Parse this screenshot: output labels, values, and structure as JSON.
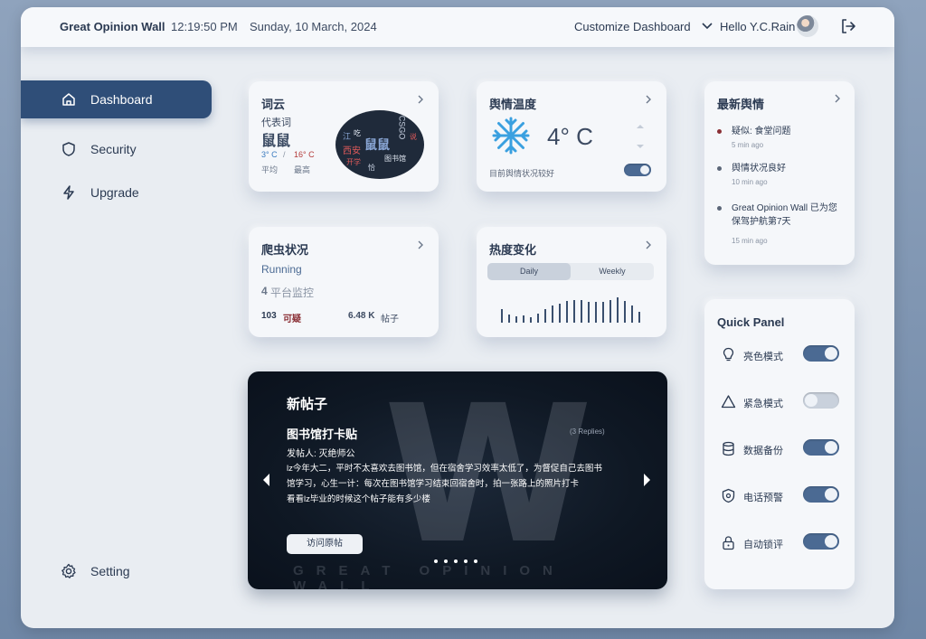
{
  "topbar": {
    "brand": "Great Opinion Wall",
    "time": "12:19:50 PM",
    "date": "Sunday, 10 March, 2024",
    "customize": "Customize Dashboard",
    "hello": "Hello Y.C.Rain"
  },
  "sidebar": {
    "items": [
      {
        "label": "Dashboard",
        "icon": "home-icon",
        "active": true
      },
      {
        "label": "Security",
        "icon": "shield-icon"
      },
      {
        "label": "Upgrade",
        "icon": "lightning-icon"
      }
    ],
    "setting": "Setting"
  },
  "wordcloud": {
    "title": "词云",
    "rep_label": "代表词",
    "word": "鼠鼠",
    "temp_low": "3° C",
    "sep": "/",
    "temp_high": "16° C",
    "avg_label": "平均",
    "max_label": "最高",
    "cloud_words": [
      "鼠鼠",
      "CSGO",
      "西安",
      "开学",
      "图书馆",
      "说",
      "吃",
      "江",
      "恰"
    ]
  },
  "sentiment": {
    "title": "舆情温度",
    "value": "4° C",
    "status": "目前舆情状况较好"
  },
  "news": {
    "title": "最新舆情",
    "items": [
      {
        "text": "疑似: 食堂问题",
        "time": "5 min ago",
        "color": "#8a2f35"
      },
      {
        "text": "舆情状况良好",
        "time": "10 min ago",
        "color": "#5b6678"
      },
      {
        "text": "Great Opinion Wall 已为您保驾护航第7天",
        "time": "15 min ago",
        "color": "#5b6678"
      }
    ]
  },
  "crawler": {
    "title": "爬虫状况",
    "status": "Running",
    "platforms_num": "4",
    "platforms_label": "平台监控",
    "suspicious_num": "103",
    "suspicious_label": "可疑",
    "posts_num": "6.48 K",
    "posts_label": "帖子"
  },
  "heat": {
    "title": "热度变化",
    "tabs": [
      "Daily",
      "Weekly"
    ],
    "active_tab": "Daily",
    "values": [
      14,
      9,
      7,
      8,
      6,
      10,
      14,
      18,
      20,
      23,
      24,
      24,
      22,
      22,
      22,
      24,
      27,
      23,
      18,
      12
    ]
  },
  "quick_panel": {
    "title": "Quick Panel",
    "items": [
      {
        "label": "亮色模式",
        "icon": "bulb-icon",
        "on": true
      },
      {
        "label": "紧急模式",
        "icon": "warning-icon",
        "on": false
      },
      {
        "label": "数据备份",
        "icon": "database-icon",
        "on": true
      },
      {
        "label": "电话预警",
        "icon": "shield-alert-icon",
        "on": true
      },
      {
        "label": "自动锁评",
        "icon": "lock-icon",
        "on": true
      }
    ]
  },
  "post": {
    "section": "新帖子",
    "title": "图书馆打卡贴",
    "replies": "(3 Replies)",
    "author": "发帖人: 灭绝师公",
    "body_line1": "lz今年大二，平时不太喜欢去图书馆，但在宿舍学习效率太低了，为督促自己去图书",
    "body_line2": "馆学习，心生一计：每次在图书馆学习结束回宿舍时，拍一张路上的照片打卡",
    "body_line3": "看看lz毕业的时候这个帖子能有多少楼",
    "button": "访问原帖",
    "watermark": "GREAT OPINION WALL",
    "logo_letter": "W"
  }
}
